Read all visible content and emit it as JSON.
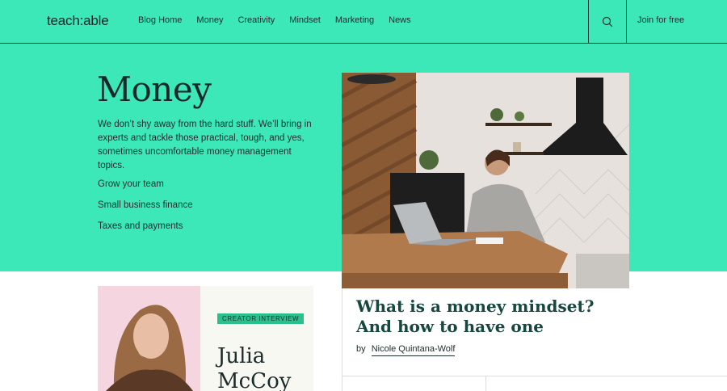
{
  "header": {
    "logo": "teach:able",
    "nav": [
      "Blog Home",
      "Money",
      "Creativity",
      "Mindset",
      "Marketing",
      "News"
    ],
    "search_icon": "search-icon",
    "join_label": "Join for free"
  },
  "hero": {
    "title": "Money",
    "description": "We don’t shy away from the hard stuff. We’ll bring in experts and tackle those practical, tough, and yes, sometimes uncomfortable money management topics.",
    "subcategories": [
      "Grow your team",
      "Small business finance",
      "Taxes and payments"
    ]
  },
  "featured": {
    "title": "What is a money mindset? And how to have one",
    "by_label": "by",
    "author": "Nicole Quintana-Wolf"
  },
  "interview_card": {
    "badge": "CREATOR INTERVIEW",
    "name_line1": "Julia",
    "name_line2": "McCoy"
  },
  "colors": {
    "brand_green": "#3de8b8",
    "badge_green": "#2bbf8e",
    "card_pink": "#f4d5e0",
    "title_teal": "#17473f"
  }
}
